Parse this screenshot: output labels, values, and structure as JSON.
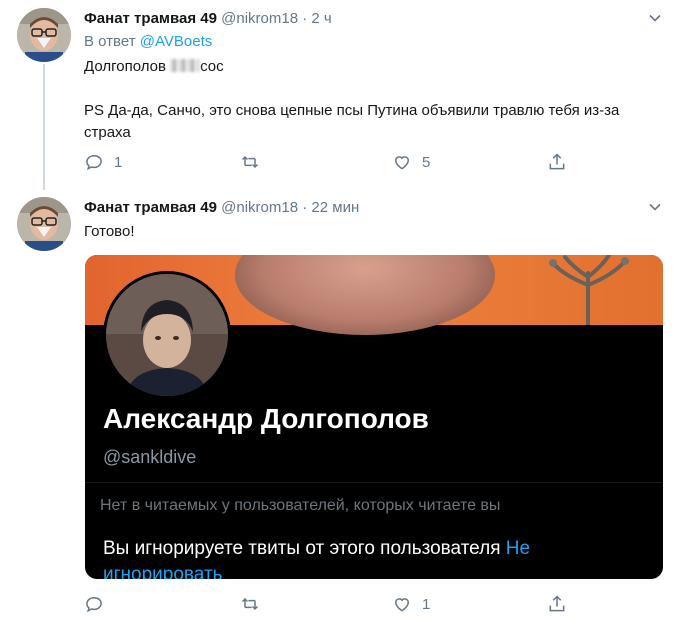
{
  "tweet1": {
    "name": "Фанат трамвая 49",
    "handle": "@nikrom18",
    "dot": "·",
    "time": "2 ч",
    "reply_prefix": "В ответ",
    "reply_to": "@AVBoets",
    "line1_before": "Долгополов",
    "line1_after": "сос",
    "line2": "PS Да-да, Санчо, это снова цепные псы Путина объявили травлю тебя из-за страха",
    "reply_count": "1",
    "retweet_count": "",
    "like_count": "5"
  },
  "tweet2": {
    "name": "Фанат трамвая 49",
    "handle": "@nikrom18",
    "dot": "·",
    "time": "22 мин",
    "text": "Готово!",
    "reply_count": "",
    "retweet_count": "",
    "like_count": "1",
    "card": {
      "name": "Александр Долгополов",
      "handle": "@sankldive",
      "note": "Нет в читаемых у пользователей, которых читаете вы",
      "blocked_text": "Вы игнорируете твиты от этого пользователя",
      "unblock_link": "Не игнорировать"
    }
  },
  "colors": {
    "accent": "#1da1f2",
    "muted": "#657786",
    "text": "#14171a"
  },
  "icons": [
    "reply-icon",
    "retweet-icon",
    "like-icon",
    "share-icon",
    "chevron-down-icon"
  ]
}
